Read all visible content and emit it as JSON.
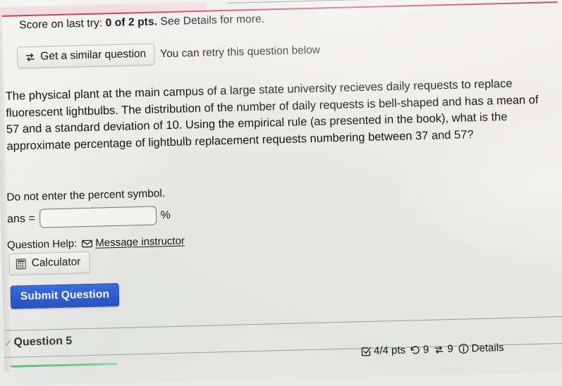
{
  "score": {
    "prefix": "Score on last try:",
    "points": "0 of 2 pts.",
    "suffix": "See Details for more."
  },
  "retry": {
    "similar_button_label": "Get a similar question",
    "similar_icon": "swap-arrows-icon",
    "note": "You can retry this question below"
  },
  "question": {
    "text": "The physical plant at the main campus of a large state university recieves daily requests to replace fluorescent lightbulbs. The distribution of the number of daily requests is bell-shaped and has a mean of 57 and a standard deviation of 10. Using the empirical rule (as presented in the book), what is the approximate percentage of lightbulb replacement requests numbering between 37 and 57?"
  },
  "answer": {
    "instruction": "Do not enter the percent symbol.",
    "label": "ans =",
    "value": "",
    "placeholder": "",
    "unit": "%"
  },
  "help": {
    "label": "Question Help:",
    "message_link": "Message instructor",
    "message_icon": "envelope-icon",
    "calculator_label": "Calculator",
    "calculator_icon": "calculator-icon"
  },
  "submit": {
    "label": "Submit Question"
  },
  "next_question": {
    "title": "Question 5",
    "status_icon": "check-icon"
  },
  "footer": {
    "points": "4/4 pts",
    "points_icon": "checkbox-check-icon",
    "attempts_icon": "undo-arrow-icon",
    "attempts": "9",
    "swaps_icon": "swap-arrows-icon",
    "swaps": "9",
    "details_icon": "info-circle-icon",
    "details_label": "Details"
  },
  "colors": {
    "submit_blue": "#1340bd",
    "top_rule_red": "#c9445c",
    "progress_green": "#3fbf6a",
    "page_background": "#e9e9e7"
  }
}
